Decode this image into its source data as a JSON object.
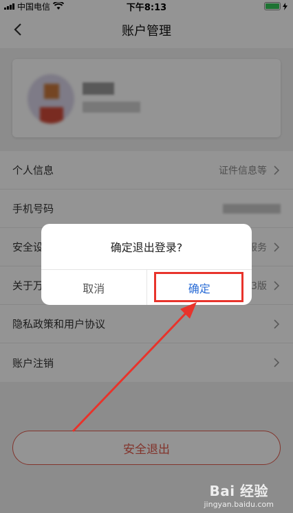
{
  "status_bar": {
    "carrier": "中国电信",
    "time": "下午8:13"
  },
  "nav": {
    "title": "账户管理"
  },
  "menu": {
    "items": [
      {
        "label": "个人信息",
        "value": "证件信息等"
      },
      {
        "label": "手机号码",
        "value": ""
      },
      {
        "label": "安全设",
        "value": "服务"
      },
      {
        "label": "关于万",
        "value": "3版"
      },
      {
        "label": "隐私政策和用户协议",
        "value": ""
      },
      {
        "label": "账户注销",
        "value": ""
      }
    ]
  },
  "logout": {
    "label": "安全退出"
  },
  "dialog": {
    "message": "确定退出登录?",
    "cancel_label": "取消",
    "confirm_label": "确定"
  },
  "watermark": {
    "brand": "Bai 经验",
    "url": "jingyan.baidu.com"
  },
  "colors": {
    "accent_red": "#e05a4c",
    "confirm_blue": "#2a6cd6",
    "annotation_red": "#e8332b"
  }
}
